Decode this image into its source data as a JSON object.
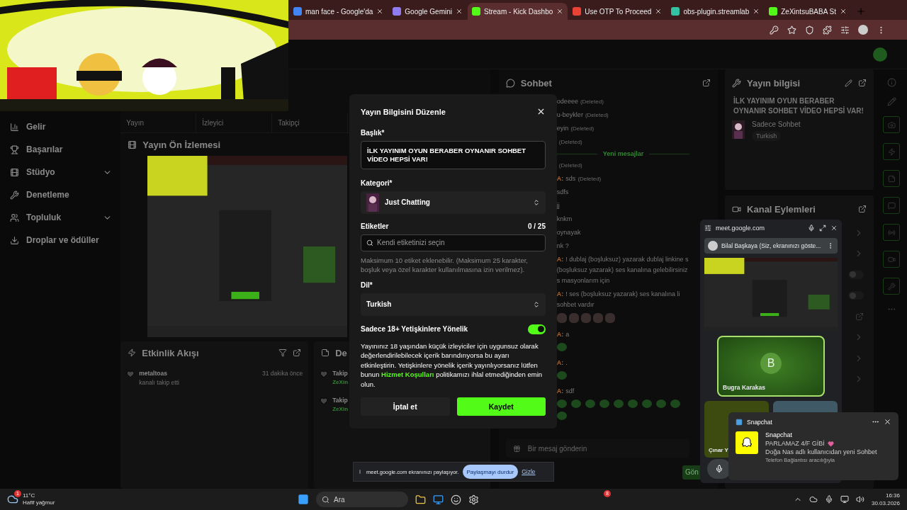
{
  "browser": {
    "tabs": [
      {
        "title": "man face - Google'da",
        "selected": false
      },
      {
        "title": "Google Gemini",
        "selected": false
      },
      {
        "title": "Stream - Kick Dashbo",
        "selected": true
      },
      {
        "title": "Use OTP To Proceed",
        "selected": false
      },
      {
        "title": "obs-plugin.streamlab",
        "selected": false
      },
      {
        "title": "ZeXintsuBABA St",
        "selected": false
      }
    ]
  },
  "sidebar": {
    "items": [
      {
        "label": "Gelir",
        "expandable": false
      },
      {
        "label": "Başarılar",
        "expandable": false
      },
      {
        "label": "Stüdyo",
        "expandable": true
      },
      {
        "label": "Denetleme",
        "expandable": false
      },
      {
        "label": "Topluluk",
        "expandable": true
      },
      {
        "label": "Droplar ve ödüller",
        "expandable": false
      }
    ]
  },
  "stats": {
    "cells": [
      "Yayın",
      "İzleyici",
      "Takipçi"
    ]
  },
  "preview": {
    "title": "Yayın Ön İzlemesi"
  },
  "activity": {
    "title": "Etkinlik Akışı",
    "events": [
      {
        "user": "metaltoas",
        "action": "kanalı takip etti",
        "time": "31 dakika önce"
      }
    ]
  },
  "events_panel": {
    "title": "De",
    "items": [
      {
        "label": "Takip",
        "user": "ZeXin"
      },
      {
        "label": "Takip",
        "user": "ZeXin"
      }
    ]
  },
  "chat": {
    "title": "Sohbet",
    "messages": [
      {
        "kind": "message",
        "text": "odeeee",
        "note": "(Deleted)"
      },
      {
        "kind": "message",
        "text": "u-beykler",
        "note": "(Deleted)"
      },
      {
        "kind": "message",
        "text": "eyin",
        "note": "(Deleted)"
      },
      {
        "kind": "message",
        "note": "(Deleted)"
      },
      {
        "kind": "divider",
        "text": "Yeni mesajlar"
      },
      {
        "kind": "message",
        "note": "(Deleted)"
      },
      {
        "kind": "message",
        "user": "A:",
        "text": "sds",
        "note": "(Deleted)"
      },
      {
        "kind": "message",
        "text": "sdfs"
      },
      {
        "kind": "message",
        "text": "jj"
      },
      {
        "kind": "message",
        "text": "knkm"
      },
      {
        "kind": "message",
        "text": "oynayak"
      },
      {
        "kind": "message",
        "text": "nk ?"
      },
      {
        "kind": "message",
        "user": "A:",
        "text": "! dublaj (boşluksuz) yazarak dublaj linkine s (boşluksuz yazarak) ses kanalına gelebilirsiniz s masyonlarım için"
      },
      {
        "kind": "message",
        "user": "A:",
        "text": "! ses (boşluksuz yazarak) ses kanalına li sohbet vardır"
      },
      {
        "kind": "cats"
      },
      {
        "kind": "message",
        "user": "A:",
        "text": "a"
      },
      {
        "kind": "blob"
      },
      {
        "kind": "message",
        "user": "A:",
        "text": "."
      },
      {
        "kind": "blob"
      },
      {
        "kind": "message",
        "user": "A:",
        "text": "sdf"
      },
      {
        "kind": "blob-row"
      }
    ],
    "input_placeholder": "Bir mesaj gönderin",
    "send_label": "Gön"
  },
  "stream_info": {
    "title": "Yayın bilgisi",
    "stream_title": "İLK YAYINIM OYUN BERABER OYNANIR SOHBET VİDEO HEPSİ VAR!",
    "category": "Sadece Sohbet",
    "language": "Turkish"
  },
  "channel_actions": {
    "title": "Kanal Eylemleri",
    "rows": [
      {
        "kind": "chevron"
      },
      {
        "kind": "chevron"
      },
      {
        "kind": "toggle",
        "on": false
      },
      {
        "kind": "toggle",
        "on": false
      },
      {
        "kind": "external"
      },
      {
        "kind": "chevron"
      },
      {
        "kind": "chevron"
      },
      {
        "kind": "chevron"
      }
    ]
  },
  "modal": {
    "title": "Yayın Bilgisini Düzenle",
    "title_label": "Başlık*",
    "title_value": "İLK YAYINIM OYUN BERABER OYNANIR SOHBET VİDEO HEPSİ VAR!",
    "category_label": "Kategori*",
    "category": "Just Chatting",
    "tags_label": "Etiketler",
    "tags_count": "0 / 25",
    "tags_placeholder": "Kendi etiketinizi seçin",
    "tags_hint": "Maksimum 10 etiket eklenebilir. (Maksimum 25 karakter, boşluk veya özel karakter kullanılmasına izin verilmez).",
    "language_label": "Dil*",
    "language": "Turkish",
    "mature_label": "Sadece 18+ Yetişkinlere Yönelik",
    "mature_on": true,
    "mature_text_before": "Yayınınız 18 yaşından küçük izleyiciler için uygunsuz olarak değerlendirilebilecek içerik barındırıyorsa bu ayarı etkinleştirin. Yetişkinlere yönelik içerik yayınlıyorsanız lütfen bunun",
    "mature_link": "Hizmet Koşulları",
    "mature_text_after": "politikamızı ihlal etmediğinden emin olun.",
    "cancel": "İptal et",
    "save": "Kaydet"
  },
  "meet": {
    "url": "meet.google.com",
    "presenter": "Bilal Başkaya (Siz, ekranınızı göste...",
    "participant_initial": "B",
    "participant": "Bugra Karakas",
    "participant_2": "Çınar Y"
  },
  "toast": {
    "app": "Snapchat",
    "sender": "Snapchat",
    "message": "PARLAMAZ 4/F GİBİ",
    "body": "Doğa Nas adlı kullanıcıdan yeni Sohbet",
    "via": "Telefon Bağlantısı aracılığıyla"
  },
  "share_bar": {
    "text": "meet.google.com ekranınızı paylaşıyor.",
    "stop": "Paylaşmayı durdur",
    "hide": "Gizle"
  },
  "taskbar": {
    "weather_badge": "1",
    "temperature": "11°C",
    "weather": "Hafif yağmur",
    "search": "Ara",
    "chrome_badge": "8",
    "time": "16:36",
    "date": "30.03.2026"
  }
}
